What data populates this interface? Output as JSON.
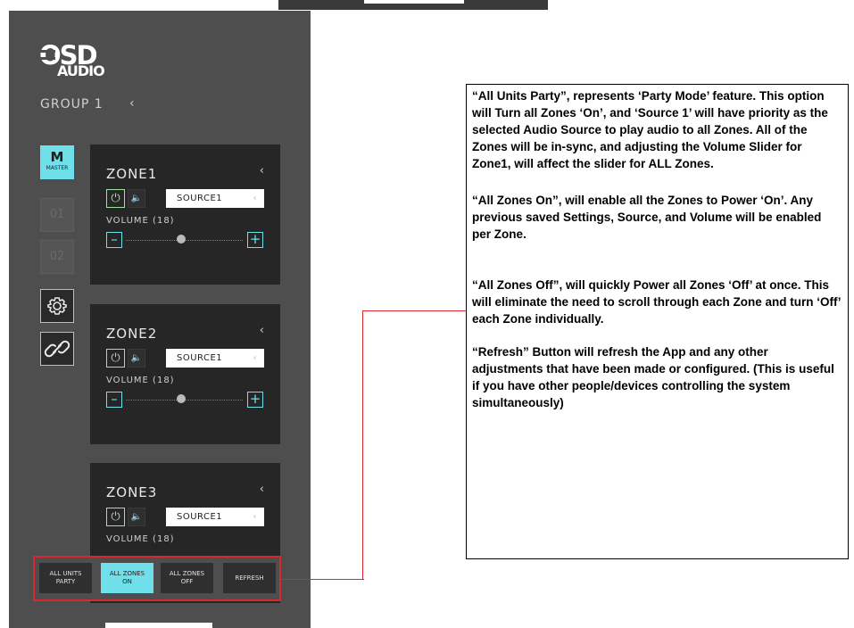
{
  "app": {
    "logo": {
      "line1": "OSD",
      "line2": "AUDIO"
    },
    "group": {
      "title": "GROUP 1",
      "chevron": "‹"
    },
    "sidebar": {
      "master": {
        "label": "M",
        "sub": "MASTER"
      },
      "items": [
        {
          "label": "01"
        },
        {
          "label": "02"
        }
      ],
      "settings_icon": "gear-icon",
      "link_icon": "link-icon"
    },
    "zones": [
      {
        "name": "ZONE1",
        "source": "SOURCE1",
        "volume_label": "VOLUME (18)",
        "volume": 18,
        "power": "on"
      },
      {
        "name": "ZONE2",
        "source": "SOURCE1",
        "volume_label": "VOLUME (18)",
        "volume": 18,
        "power": "on"
      },
      {
        "name": "ZONE3",
        "source": "SOURCE1",
        "volume_label": "VOLUME (18)",
        "volume": 18,
        "power": "on"
      }
    ],
    "quick_buttons": [
      {
        "line1": "ALL UNITS",
        "line2": "PARTY"
      },
      {
        "line1": "ALL ZONES",
        "line2": "ON",
        "active": true
      },
      {
        "line1": "ALL ZONES",
        "line2": "OFF"
      },
      {
        "line1": "REFRESH",
        "line2": ""
      }
    ],
    "accent_color": "#6fe0ea",
    "power_color": "#9be69b",
    "highlight_color": "#d8282d"
  },
  "callout": {
    "p1": "“All Units Party”, represents ‘Party Mode’ feature. This option will Turn all Zones ‘On’, and ‘Source 1’ will have priority as the selected Audio Source to play audio to all Zones. All of the Zones will be in-sync, and adjusting the Volume Slider for Zone1, will affect the slider for ALL Zones.",
    "p2": "“All Zones On”, will enable all the Zones to Power ‘On’. Any previous saved Settings, Source, and Volume will be enabled per Zone.",
    "p3": "“All Zones Off”, will quickly Power all Zones ‘Off’ at once. This will eliminate the need to scroll through each Zone and turn ‘Off’ each Zone individually.",
    "p4": "“Refresh” Button will refresh the App and any other adjustments that have been made or configured. (This is useful if you have other people/devices controlling the system simultaneously)"
  }
}
